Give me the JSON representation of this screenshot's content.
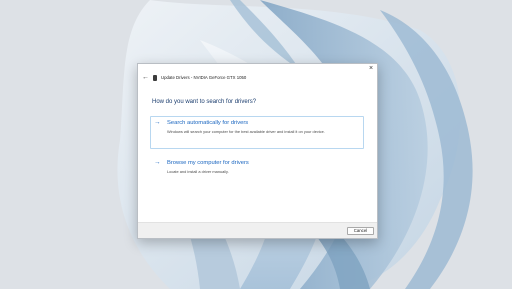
{
  "dialog": {
    "title": "Update Drivers - NVIDIA GeForce GTX 1050",
    "back_icon": "back-arrow-icon",
    "app_icon": "device-icon",
    "close_label": "×",
    "question": "How do you want to search for drivers?",
    "options": [
      {
        "arrow": "→",
        "title": "Search automatically for drivers",
        "description": "Windows will search your computer for the best available driver and install it on your device."
      },
      {
        "arrow": "→",
        "title": "Browse my computer for drivers",
        "description": "Locate and install a driver manually."
      }
    ],
    "cancel_label": "Cancel"
  },
  "colors": {
    "accent": "#1a66c0",
    "heading": "#1b3d6e",
    "wallpaper_base": "#d9dde2",
    "wallpaper_blue": "#8fb2cf"
  }
}
